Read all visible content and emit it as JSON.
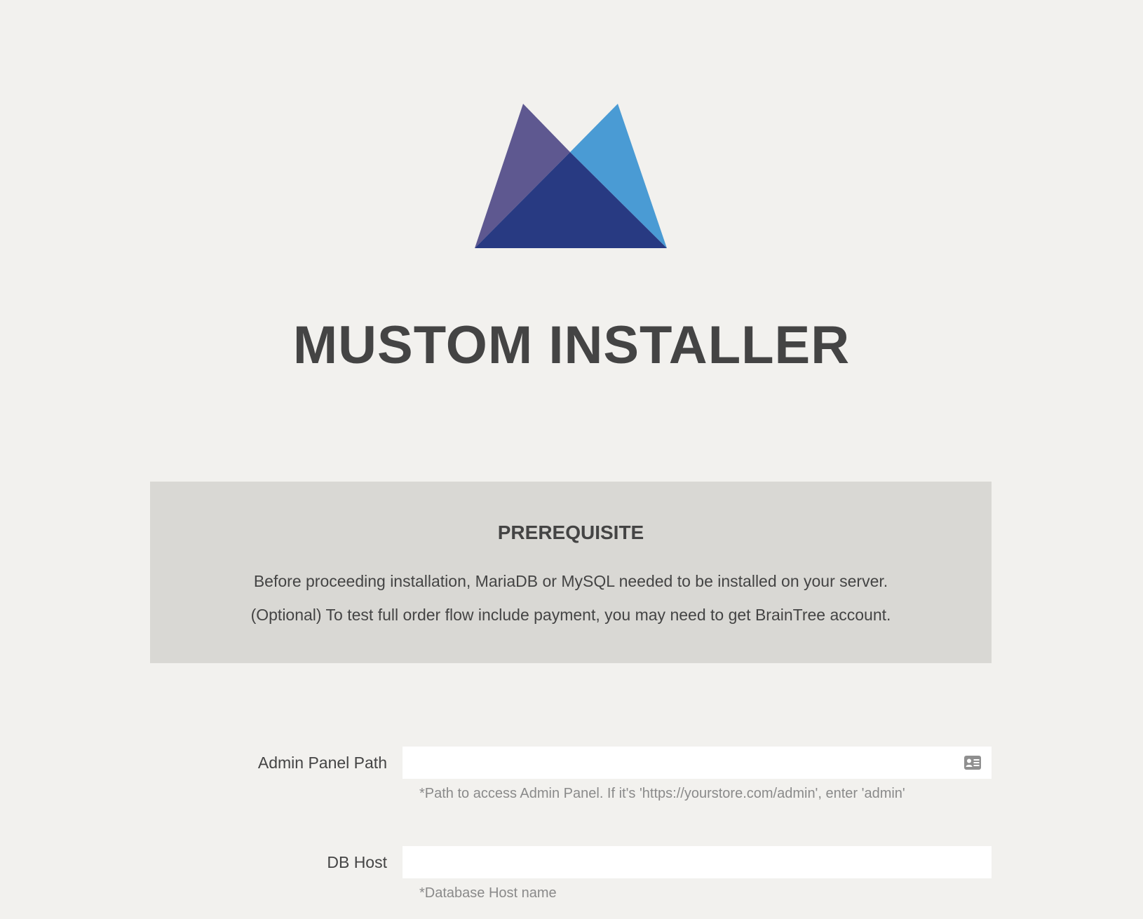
{
  "brand": {
    "logo_icon": "mountain-m-logo-icon",
    "colors": {
      "left_peak": "#5e5890",
      "right_peak": "#4a9bd4",
      "center": "#283a82"
    }
  },
  "page_title": "MUSTOM INSTALLER",
  "prerequisite": {
    "heading": "PREREQUISITE",
    "line1": "Before proceeding installation, MariaDB or MySQL needed to be installed on your server.",
    "line2": "(Optional) To test full order flow include payment, you may need to get BrainTree account."
  },
  "form": {
    "admin_path": {
      "label": "Admin Panel Path",
      "value": "",
      "placeholder": "",
      "help": "*Path to access Admin Panel. If it's 'https://yourstore.com/admin', enter 'admin'",
      "icon": "contact-card-icon"
    },
    "db_host": {
      "label": "DB Host",
      "value": "",
      "placeholder": "",
      "help": "*Database Host name"
    }
  }
}
